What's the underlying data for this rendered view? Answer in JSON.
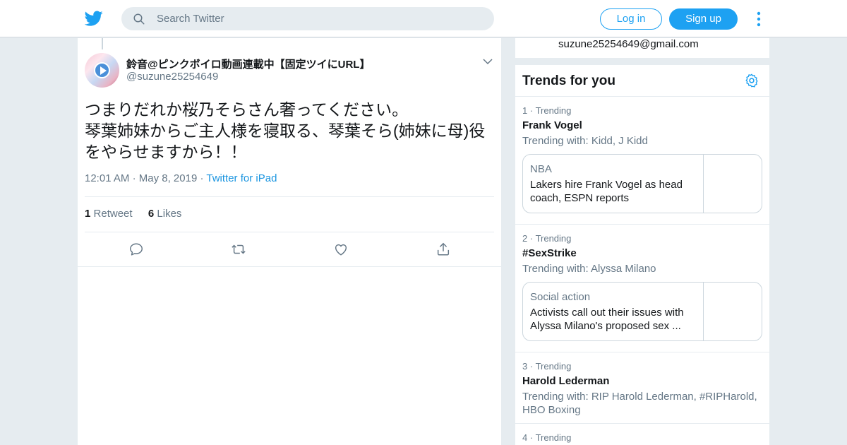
{
  "header": {
    "search_placeholder": "Search Twitter",
    "login_label": "Log in",
    "signup_label": "Sign up",
    "accent_color": "#1da1f2"
  },
  "tweet": {
    "display_name": "鈴音@ピンクボイロ動画連載中【固定ツイにURL】",
    "handle": "@suzune25254649",
    "text": "つまりだれか桜乃そらさん奢ってください。\n琴葉姉妹からご主人様を寝取る、琴葉そら(姉妹に母)役をやらせますから！！",
    "time": "12:01 AM",
    "date": "May 8, 2019",
    "source": "Twitter for iPad",
    "retweet_count": "1",
    "retweet_label": "Retweet",
    "like_count": "6",
    "like_label": "Likes"
  },
  "sidebar": {
    "email": "suzune25254649@gmail.com",
    "trends_title": "Trends for you",
    "trends": [
      {
        "rank": "1",
        "label": "Trending",
        "name": "Frank Vogel",
        "with": "Trending with: Kidd, J Kidd",
        "card": {
          "category": "NBA",
          "headline": "Lakers hire Frank Vogel as head coach, ESPN reports"
        }
      },
      {
        "rank": "2",
        "label": "Trending",
        "name": "#SexStrike",
        "with": "Trending with: Alyssa Milano",
        "card": {
          "category": "Social action",
          "headline": "Activists call out their issues with Alyssa Milano's proposed sex ..."
        }
      },
      {
        "rank": "3",
        "label": "Trending",
        "name": "Harold Lederman",
        "with": "Trending with: RIP Harold Lederman, #RIPHarold, HBO Boxing"
      },
      {
        "rank": "4",
        "label": "Trending"
      }
    ]
  }
}
